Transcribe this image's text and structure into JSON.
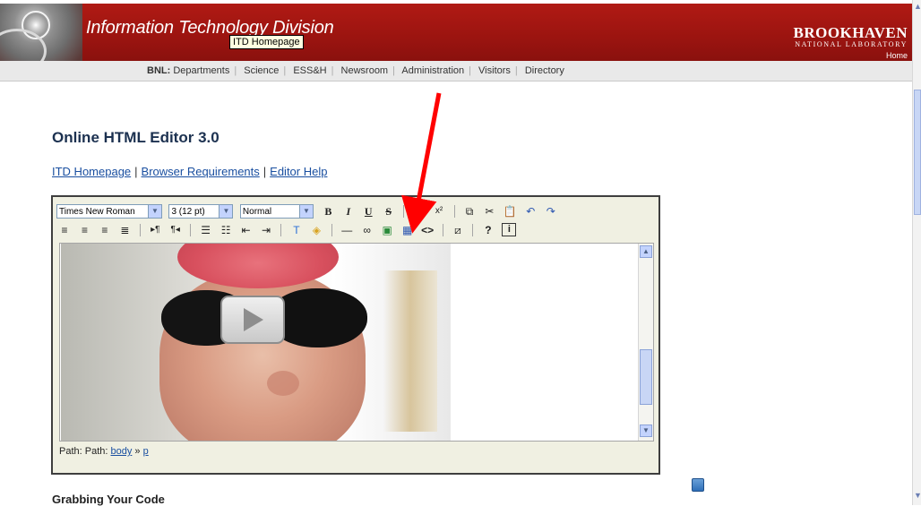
{
  "header": {
    "title": "Information Technology Division",
    "tooltip": "ITD Homepage",
    "logo_main": "BROOKHAVEN",
    "logo_sub": "NATIONAL LABORATORY",
    "home_label": "Home",
    "accent_color": "#9b1410"
  },
  "nav": {
    "lead": "BNL:",
    "items": [
      "Departments",
      "Science",
      "ESS&H",
      "Newsroom",
      "Administration",
      "Visitors",
      "Directory"
    ]
  },
  "page": {
    "title": "Online HTML Editor 3.0",
    "links": [
      "ITD Homepage",
      "Browser Requirements",
      "Editor Help"
    ],
    "subheading": "Grabbing Your Code"
  },
  "editor": {
    "font_select": "Times New Roman",
    "size_select": "3 (12 pt)",
    "format_select": "Normal",
    "path_label": "Path: Path:",
    "path_items": [
      "body",
      "p"
    ],
    "path_sep": "»",
    "toolbar_row1_icons": [
      "bold-icon",
      "italic-icon",
      "underline-icon",
      "strikethrough-icon",
      "subscript-icon",
      "superscript-icon",
      "copy-icon",
      "cut-icon",
      "paste-icon",
      "undo-icon",
      "redo-icon"
    ],
    "toolbar_row2_icons": [
      "align-left-icon",
      "align-center-icon",
      "align-right-icon",
      "justify-icon",
      "ltr-icon",
      "rtl-icon",
      "ordered-list-icon",
      "unordered-list-icon",
      "outdent-icon",
      "indent-icon",
      "text-color-icon",
      "highlight-color-icon",
      "horizontal-rule-icon",
      "link-icon",
      "image-icon",
      "table-icon",
      "html-source-icon",
      "fullscreen-icon",
      "help-icon",
      "about-icon"
    ]
  },
  "annotation": {
    "arrow_color": "#ff0000"
  }
}
